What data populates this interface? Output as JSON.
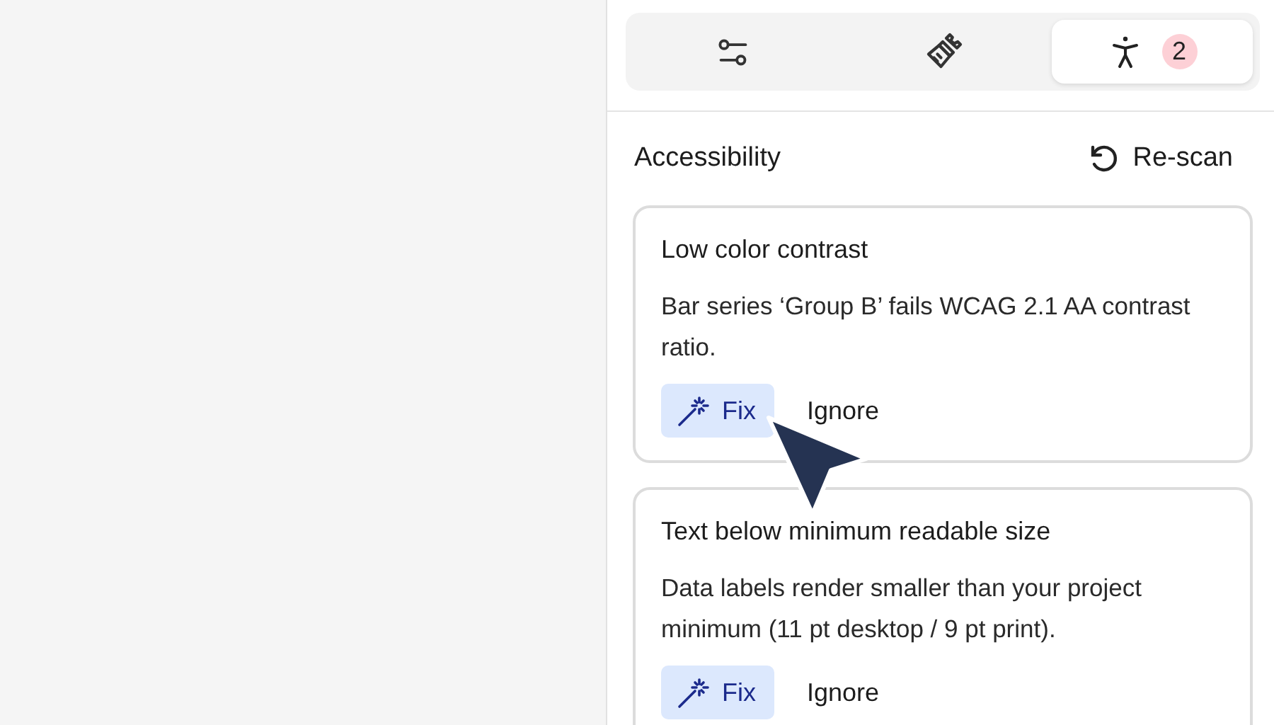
{
  "tabs": [
    {
      "kind": "sliders",
      "selected": false
    },
    {
      "kind": "brush",
      "selected": false
    },
    {
      "kind": "accessibility",
      "selected": true,
      "badge": "2"
    }
  ],
  "section": {
    "title": "Accessibility",
    "action": "Re-scan"
  },
  "issues": [
    {
      "title": "Low color contrast",
      "description": "Bar series ‘Group B’ fails WCAG 2.1 AA contrast ratio.",
      "fix": "Fix",
      "ignore": "Ignore"
    },
    {
      "title": "Text below minimum readable size",
      "description": "Data labels render smaller than your project minimum (11 pt desktop / 9 pt print).",
      "fix": "Fix",
      "ignore": "Ignore"
    }
  ]
}
